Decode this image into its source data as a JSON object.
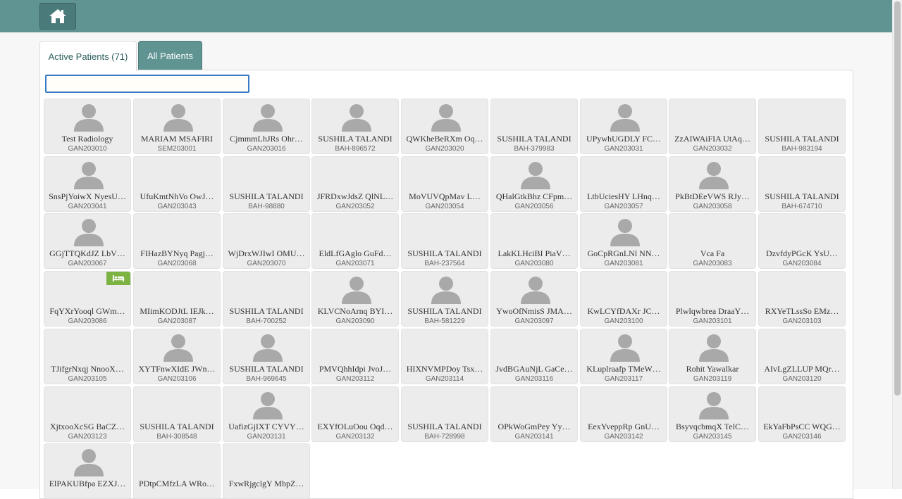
{
  "header": {
    "home_icon": "home-icon",
    "home_label": "Home"
  },
  "tabs": {
    "active": "Active Patients (71)",
    "all": "All Patients"
  },
  "search": {
    "value": "",
    "placeholder": ""
  },
  "colors": {
    "header": "#5f9493",
    "card": "#ececec",
    "bed_badge": "#7cb342",
    "search_border": "#3a7bc8"
  },
  "patients": [
    {
      "name": "Test Radiology",
      "id": "GAN203010",
      "avatar": true
    },
    {
      "name": "MARIAM MSAFIRI",
      "id": "SEM203001",
      "avatar": true
    },
    {
      "name": "CjmmmLhJRs Ohr…",
      "id": "GAN203016",
      "avatar": true
    },
    {
      "name": "SUSHILA TALANDI",
      "id": "BAH-896572",
      "avatar": true
    },
    {
      "name": "QWKheBeRXm Oq…",
      "id": "GAN203020",
      "avatar": true
    },
    {
      "name": "SUSHILA TALANDI",
      "id": "BAH-379983",
      "avatar": false
    },
    {
      "name": "UPywhUGDLY FC…",
      "id": "GAN203031",
      "avatar": true
    },
    {
      "name": "ZzAIWAiFIA UtAq…",
      "id": "GAN203032",
      "avatar": false
    },
    {
      "name": "SUSHILA TALANDI",
      "id": "BAH-983194",
      "avatar": false
    },
    {
      "name": "SnsPjYoiwX NyesU…",
      "id": "GAN203041",
      "avatar": true
    },
    {
      "name": "UfuKmtNhVo OwJ…",
      "id": "GAN203043",
      "avatar": false
    },
    {
      "name": "SUSHILA TALANDI",
      "id": "BAH-98880",
      "avatar": false
    },
    {
      "name": "JFRDxwJdsZ QlNL…",
      "id": "GAN203052",
      "avatar": false
    },
    {
      "name": "MoVUVQpMav L…",
      "id": "GAN203054",
      "avatar": false
    },
    {
      "name": "QHalGtkBhz CFpm…",
      "id": "GAN203056",
      "avatar": true
    },
    {
      "name": "LtbUciesHY LHnq…",
      "id": "GAN203057",
      "avatar": false
    },
    {
      "name": "PkBtDEeVWS RJy…",
      "id": "GAN203058",
      "avatar": true
    },
    {
      "name": "SUSHILA TALANDI",
      "id": "BAH-674710",
      "avatar": false
    },
    {
      "name": "GGjTTQKdJZ LbV…",
      "id": "GAN203067",
      "avatar": true
    },
    {
      "name": "FIHazBYNyq Pagj…",
      "id": "GAN203068",
      "avatar": false
    },
    {
      "name": "WjDrxWJIwI OMU…",
      "id": "GAN203070",
      "avatar": false
    },
    {
      "name": "EldLfGAglo GuFd…",
      "id": "GAN203071",
      "avatar": false
    },
    {
      "name": "SUSHILA TALANDI",
      "id": "BAH-237564",
      "avatar": false
    },
    {
      "name": "LakKLHciBI PiaV…",
      "id": "GAN203080",
      "avatar": false
    },
    {
      "name": "GoCpRGnLNl NN…",
      "id": "GAN203081",
      "avatar": true
    },
    {
      "name": "Vca Fa",
      "id": "GAN203083",
      "avatar": false
    },
    {
      "name": "DzvfdyPGcK YsU…",
      "id": "GAN203084",
      "avatar": false
    },
    {
      "name": "FqYXrYooql GWm…",
      "id": "GAN203086",
      "avatar": false,
      "bed": true
    },
    {
      "name": "MIimKODJtL IEJk…",
      "id": "GAN203087",
      "avatar": false
    },
    {
      "name": "SUSHILA TALANDI",
      "id": "BAH-700252",
      "avatar": false
    },
    {
      "name": "KLVCNoArnq BYI…",
      "id": "GAN203090",
      "avatar": true
    },
    {
      "name": "SUSHILA TALANDI",
      "id": "BAH-581229",
      "avatar": true
    },
    {
      "name": "YwoOfNmisS JMA…",
      "id": "GAN203097",
      "avatar": true
    },
    {
      "name": "KwLCYfDAXr JC…",
      "id": "GAN203100",
      "avatar": false
    },
    {
      "name": "Plwlqwbrea DraaY…",
      "id": "GAN203101",
      "avatar": false
    },
    {
      "name": "RXYeTLssSo EMz…",
      "id": "GAN203103",
      "avatar": false
    },
    {
      "name": "TJifgrNxqj NnooX…",
      "id": "GAN203105",
      "avatar": false
    },
    {
      "name": "XYTFnwXIdE JWn…",
      "id": "GAN203106",
      "avatar": true
    },
    {
      "name": "SUSHILA TALANDI",
      "id": "BAH-969645",
      "avatar": true
    },
    {
      "name": "PMVQhhIdpi JvoJ…",
      "id": "GAN203112",
      "avatar": false
    },
    {
      "name": "HIXNVMPDoy Tsx…",
      "id": "GAN203114",
      "avatar": false
    },
    {
      "name": "JvdBGAuNjL GaCe…",
      "id": "GAN203116",
      "avatar": false
    },
    {
      "name": "KLuplraafp TMeW…",
      "id": "GAN203117",
      "avatar": true
    },
    {
      "name": "Rohit Yawalkar",
      "id": "GAN203119",
      "avatar": true
    },
    {
      "name": "AIvLgZLLUP MQr…",
      "id": "GAN203120",
      "avatar": false
    },
    {
      "name": "XjtxooXcSG BaCZ…",
      "id": "GAN203123",
      "avatar": false
    },
    {
      "name": "SUSHILA TALANDI",
      "id": "BAH-308548",
      "avatar": false
    },
    {
      "name": "UafizGjIXT CYVY…",
      "id": "GAN203131",
      "avatar": true
    },
    {
      "name": "EXYfOLuOou Oqd…",
      "id": "GAN203132",
      "avatar": false
    },
    {
      "name": "SUSHILA TALANDI",
      "id": "BAH-728998",
      "avatar": false
    },
    {
      "name": "OPkWoGmPey Yy…",
      "id": "GAN203141",
      "avatar": false
    },
    {
      "name": "EexYveppRp GnU…",
      "id": "GAN203142",
      "avatar": false
    },
    {
      "name": "BsyvqcbmqX TelC…",
      "id": "GAN203145",
      "avatar": true
    },
    {
      "name": "EkYaFbPsCC WQG…",
      "id": "GAN203146",
      "avatar": false
    },
    {
      "name": "ElPAKUBfpa EZXJ…",
      "id": "",
      "avatar": true
    },
    {
      "name": "PDtpCMfzLA WRo…",
      "id": "",
      "avatar": false
    },
    {
      "name": "FxwRjgclgY MbpZ…",
      "id": "",
      "avatar": false
    }
  ]
}
